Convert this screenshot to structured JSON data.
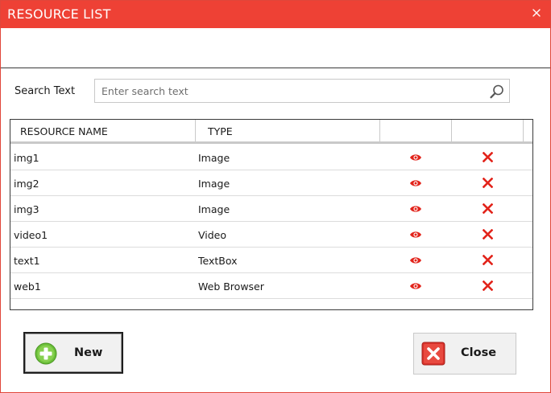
{
  "window": {
    "title": "RESOURCE LIST",
    "accent_color": "#ee4135",
    "close_icon": "close-icon"
  },
  "search": {
    "label": "Search Text",
    "value": "",
    "placeholder": "Enter search text",
    "icon": "search-icon"
  },
  "table": {
    "columns": [
      "RESOURCE NAME",
      "TYPE",
      "",
      ""
    ],
    "rows": [
      {
        "name": "img1",
        "type": "Image",
        "view_icon": "eye-icon",
        "delete_icon": "delete-x-icon"
      },
      {
        "name": "img2",
        "type": "Image",
        "view_icon": "eye-icon",
        "delete_icon": "delete-x-icon"
      },
      {
        "name": "img3",
        "type": "Image",
        "view_icon": "eye-icon",
        "delete_icon": "delete-x-icon"
      },
      {
        "name": "video1",
        "type": "Video",
        "view_icon": "eye-icon",
        "delete_icon": "delete-x-icon"
      },
      {
        "name": "text1",
        "type": "TextBox",
        "view_icon": "eye-icon",
        "delete_icon": "delete-x-icon"
      },
      {
        "name": "web1",
        "type": "Web Browser",
        "view_icon": "eye-icon",
        "delete_icon": "delete-x-icon"
      }
    ],
    "icon_color": "#e2231a"
  },
  "buttons": {
    "new_label": "New",
    "new_icon": "plus-circle-icon",
    "close_label": "Close",
    "close_icon": "close-square-icon"
  }
}
